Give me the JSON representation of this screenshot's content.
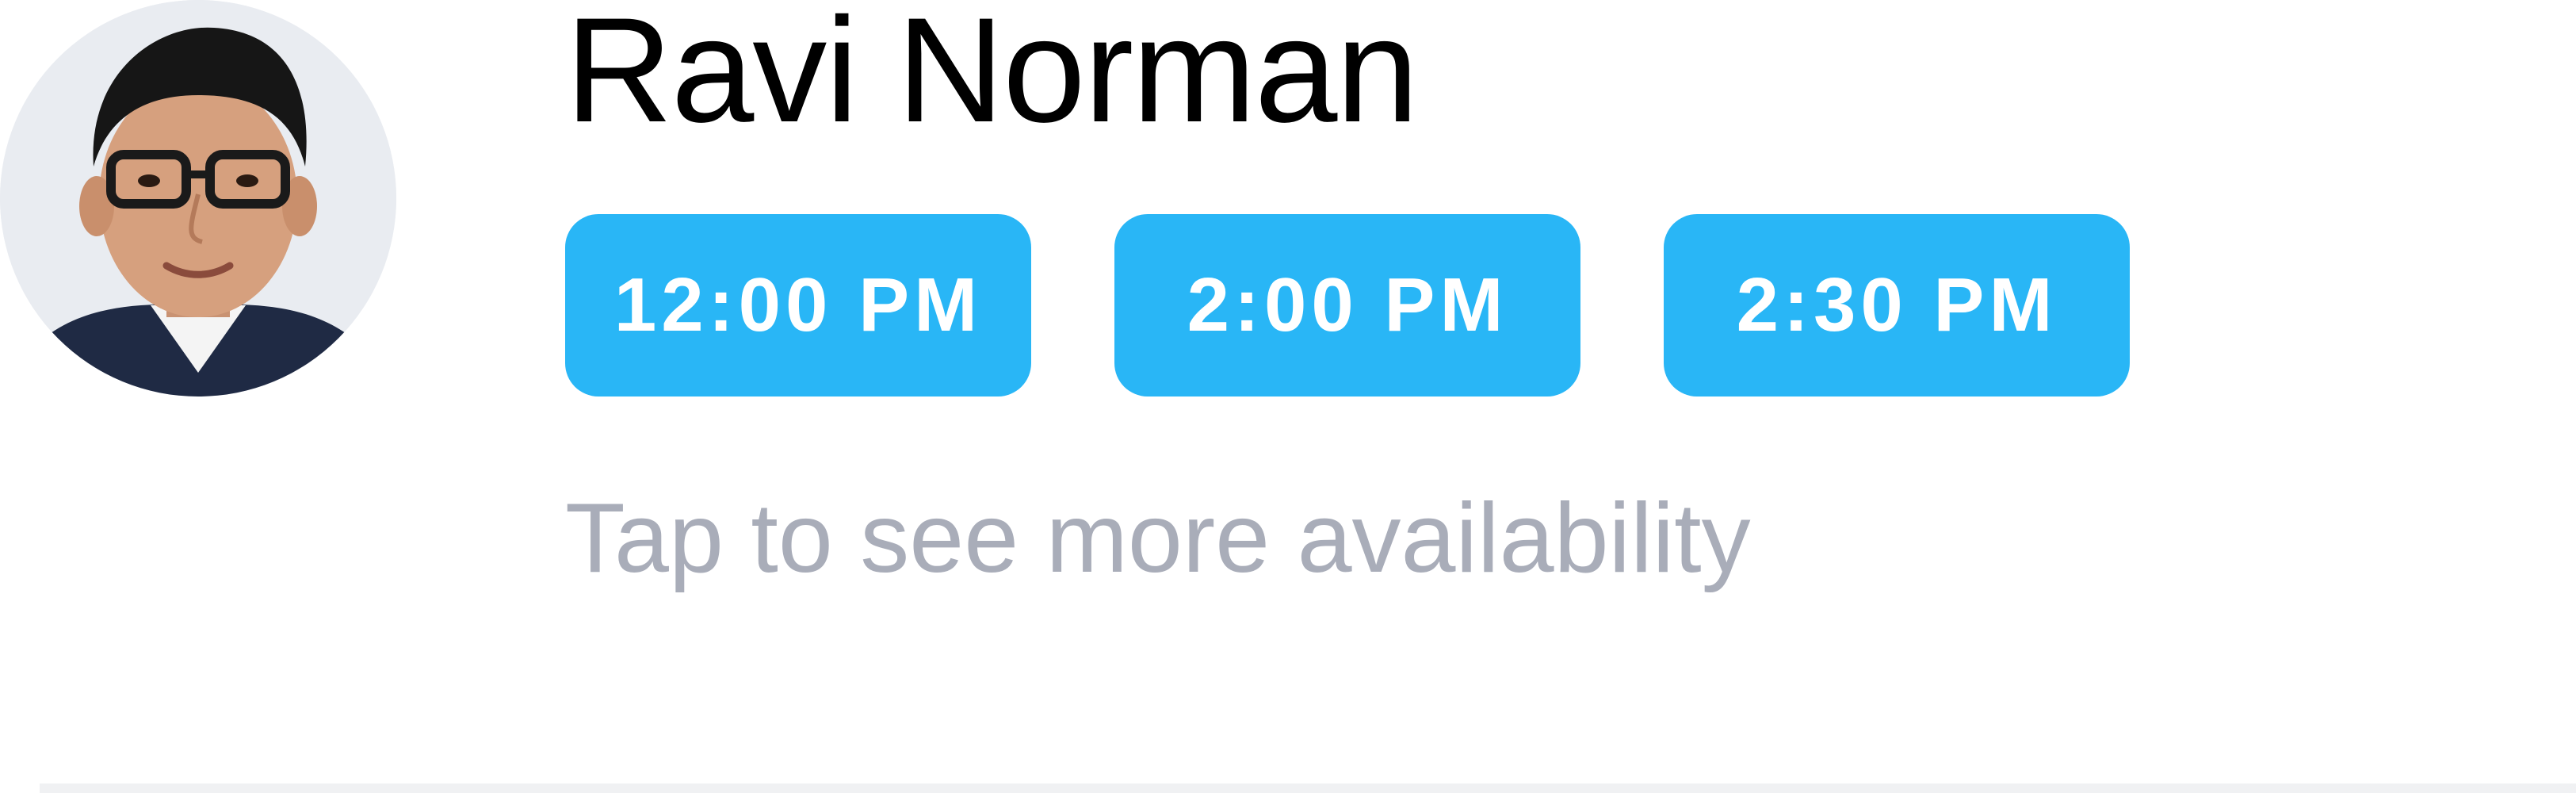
{
  "profile": {
    "name": "Ravi Norman",
    "avatar_icon": "person-photo-icon"
  },
  "slots": [
    {
      "label": "12:00 PM"
    },
    {
      "label": "2:00 PM"
    },
    {
      "label": "2:30 PM"
    }
  ],
  "more_link": "Tap to see more availability",
  "colors": {
    "accent": "#29b6f6",
    "muted_text": "#a9adb9",
    "name_text": "#000000",
    "divider": "#f0f1f3"
  }
}
